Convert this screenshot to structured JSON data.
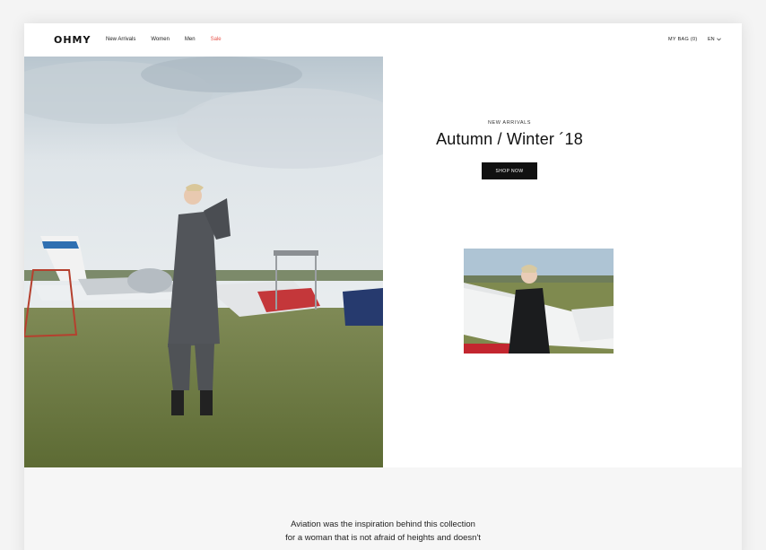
{
  "header": {
    "logo": "OHMY",
    "nav": [
      {
        "label": "New Arrivals"
      },
      {
        "label": "Women"
      },
      {
        "label": "Men"
      },
      {
        "label": "Sale"
      }
    ],
    "bag_label": "MY BAG (0)",
    "lang_label": "EN"
  },
  "hero": {
    "image": "woman-standing-airfield-photo",
    "eyebrow": "NEW ARRIVALS",
    "headline": "Autumn / Winter ´18",
    "cta_label": "SHOP NOW",
    "thumb_image": "woman-by-glider-photo"
  },
  "about": {
    "line1": "Aviation was the inspiration behind this collection",
    "line2": "for a woman that is not afraid of heights and doesn't"
  },
  "colors": {
    "sale": "#e8574f",
    "button_bg": "#111111",
    "section_bg": "#f6f6f6"
  }
}
